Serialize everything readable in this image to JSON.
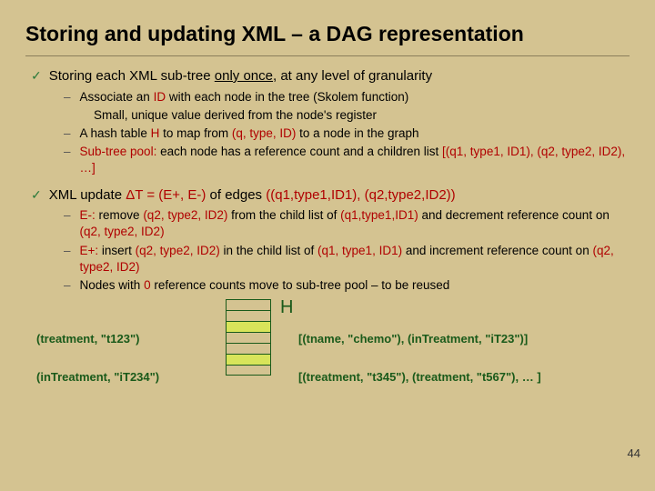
{
  "title": "Storing and updating XML – a DAG representation",
  "bullet1": {
    "prefix": "Storing each XML sub-tree ",
    "underlined": "only once",
    "suffix": ", at any level of granularity"
  },
  "sub1a": {
    "prefix": "Associate an ",
    "red1": "ID",
    "mid": " with each node in the tree  (Skolem function)"
  },
  "sub1a_cont": "Small, unique value derived from the node's register",
  "sub1b": {
    "prefix": "A hash table ",
    "red1": "H",
    "mid": " to map from ",
    "red2": "(q, type, ID)",
    "suffix": " to a node in the graph"
  },
  "sub1c": {
    "red1": "Sub-tree pool:",
    "mid": " each node has a reference count and a children list ",
    "red2": "[(q1, type1, ID1), (q2, type2, ID2), …]"
  },
  "bullet2": {
    "prefix": "XML update ",
    "red1": "ΔT = (E+, E-)",
    "mid": " of edges ",
    "red2": "((q1,type1,ID1), (q2,type2,ID2))"
  },
  "sub2a": {
    "red1": "E-: ",
    "t1": "remove ",
    "red2": "(q2, type2, ID2)",
    "t2": " from the child list of ",
    "red3": "(q1,type1,ID1)",
    "t3": " and decrement reference count on ",
    "red4": "(q2, type2, ID2)"
  },
  "sub2b": {
    "red1": "E+: ",
    "t1": "insert ",
    "red2": "(q2, type2, ID2)",
    "t2": " in the child list of ",
    "red3": "(q1, type1, ID1)",
    "t3": " and increment reference count on ",
    "red4": "(q2, type2, ID2)"
  },
  "sub2c": {
    "t1": "Nodes with ",
    "red1": "0",
    "t2": " reference counts move to sub-tree pool – to be reused"
  },
  "hash": {
    "label": "H",
    "key1": "(treatment, \"t123\")",
    "val1": "[(tname, \"chemo\"), (inTreatment, \"iT23\")]",
    "key2": "(inTreatment, \"iT234\")",
    "val2": "[(treatment, \"t345\"), (treatment, \"t567\"), … ]"
  },
  "slide_number": "44"
}
